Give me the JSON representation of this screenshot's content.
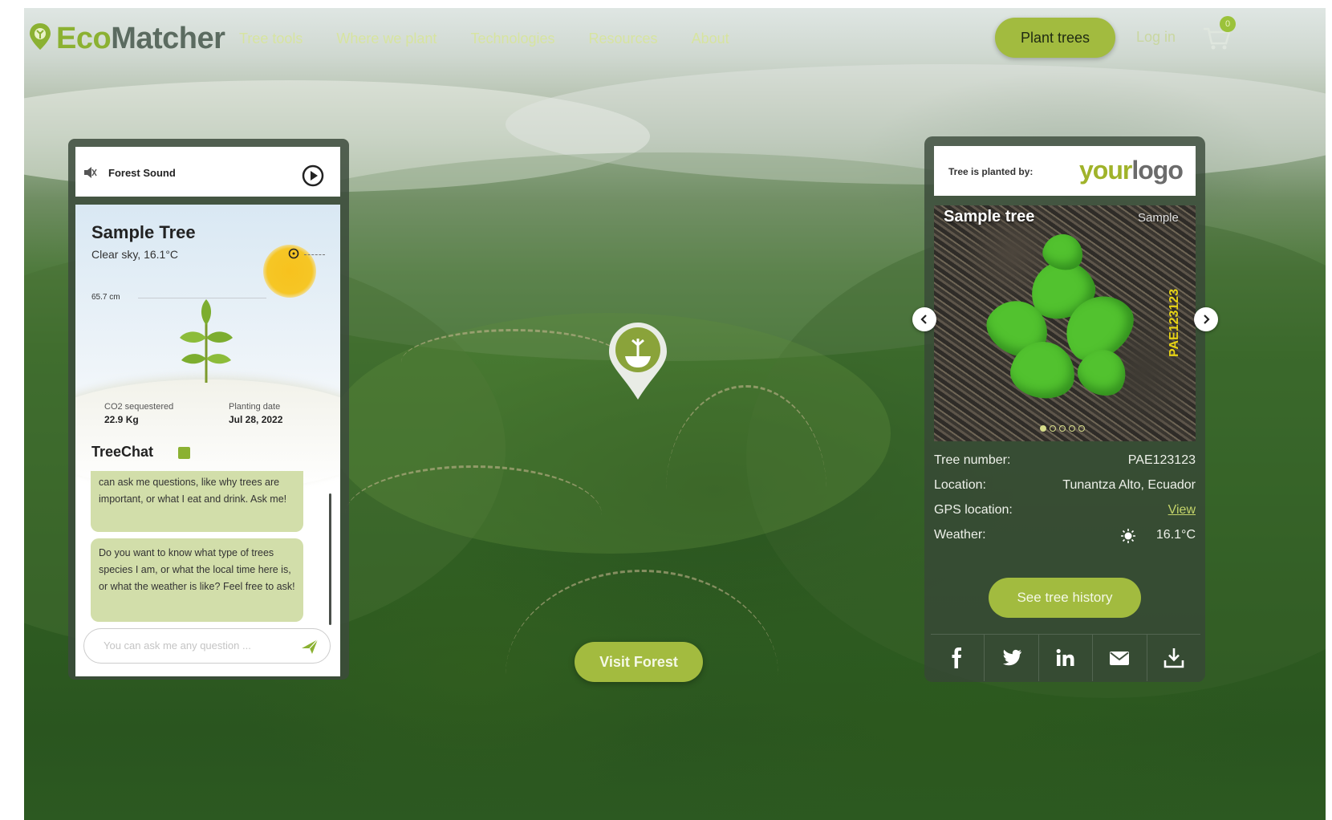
{
  "brand": {
    "eco": "Eco",
    "matcher": "Matcher"
  },
  "nav": {
    "links": [
      "Tree tools",
      "Where we plant",
      "Technologies",
      "Resources",
      "About"
    ],
    "plant_trees": "Plant trees",
    "login": "Log in",
    "cart_count": "0"
  },
  "forest_sound": {
    "label": "Forest Sound"
  },
  "tree_card": {
    "title": "Sample Tree",
    "weather": "Clear sky, 16.1°C",
    "height": "65.7 cm",
    "co2_label": "CO2 sequestered",
    "co2_value": "22.9 Kg",
    "planting_label": "Planting date",
    "planting_value": "Jul 28, 2022"
  },
  "treechat": {
    "title": "TreeChat",
    "messages": [
      "can ask me questions, like why trees are important, or what I eat and drink. Ask me!",
      "Do you want to know what type of trees species I am, or what the local time here is, or what the weather is like? Feel free to ask!"
    ],
    "input_placeholder": "You can ask me any question ..."
  },
  "visit_forest": "Visit Forest",
  "right_panel": {
    "planted_by": "Tree is planted by:",
    "logo_your": "your",
    "logo_logo": "logo",
    "photo_title": "Sample tree",
    "photo_watermark": "Sample",
    "photo_code": "PAE123123",
    "photo_index": 1,
    "photo_count": 5,
    "details": [
      {
        "label": "Tree number:",
        "value": "PAE123123"
      },
      {
        "label": "Location:",
        "value": "Tunantza Alto, Ecuador"
      },
      {
        "label": "GPS location:",
        "value": "View"
      },
      {
        "label": "Weather:",
        "value": "16.1°C"
      }
    ],
    "history_button": "See tree history",
    "share_icons": [
      "facebook-icon",
      "twitter-icon",
      "linkedin-icon",
      "email-icon",
      "download-icon"
    ]
  },
  "colors": {
    "accent_green": "#a2bb3f",
    "brand_green": "#8bb132",
    "chat_bubble": "#d2deaa"
  }
}
